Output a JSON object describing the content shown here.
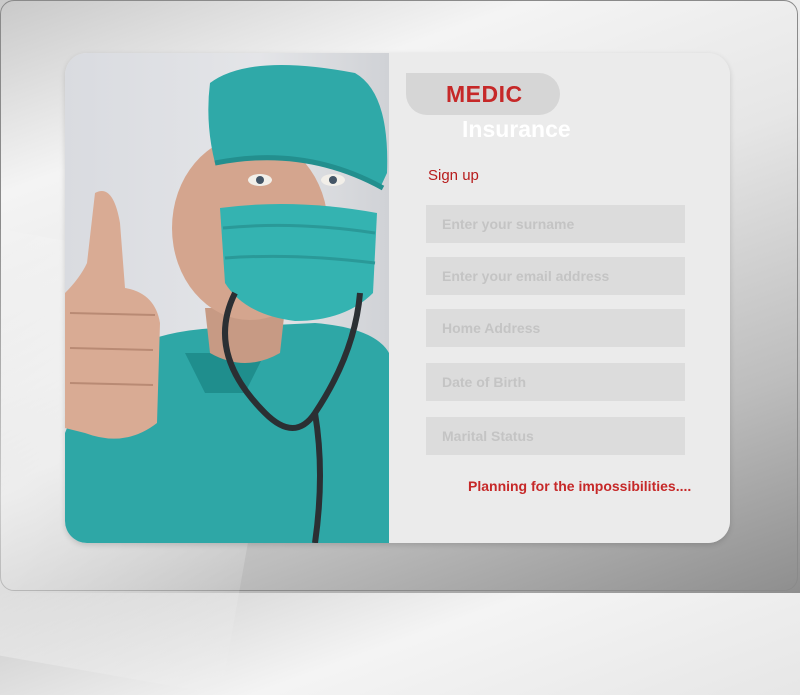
{
  "brand": {
    "name": "MEDIC",
    "subtitle": "Insurance"
  },
  "form": {
    "title": "Sign up",
    "fields": [
      {
        "placeholder": "Enter your surname"
      },
      {
        "placeholder": "Enter your email address"
      },
      {
        "placeholder": "Home Address"
      },
      {
        "placeholder": "Date of Birth"
      },
      {
        "placeholder": "Marital Status"
      }
    ]
  },
  "tagline": "Planning for the impossibilities....",
  "colors": {
    "accent": "#c62828",
    "scrubs": "#2fa9a8",
    "field_bg": "#dcdcdc"
  },
  "image": {
    "subject": "doctor-thumbs-up-photo"
  }
}
